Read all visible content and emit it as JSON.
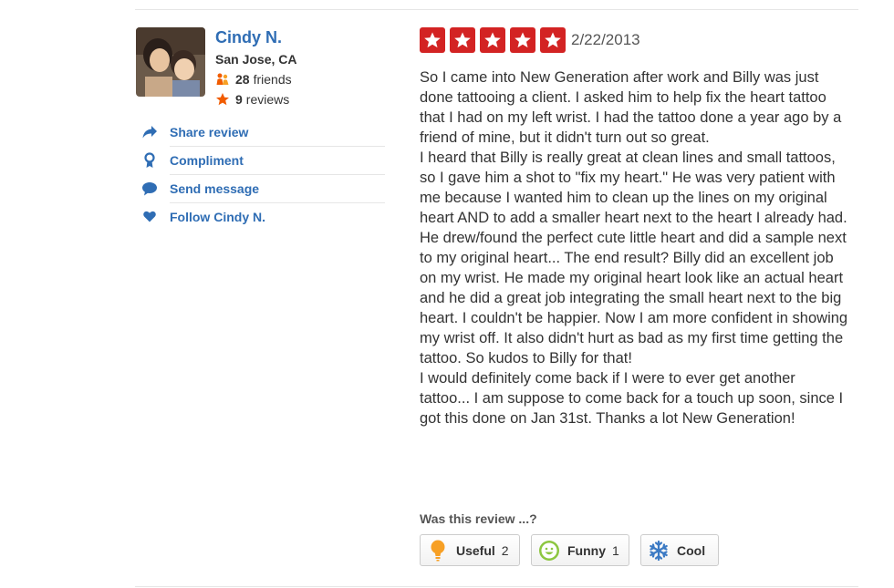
{
  "user": {
    "name": "Cindy N.",
    "location": "San Jose, CA",
    "friends_count": "28",
    "friends_label": "friends",
    "reviews_count": "9",
    "reviews_label": "reviews"
  },
  "actions": [
    {
      "label": "Share review",
      "icon": "share-arrow-icon"
    },
    {
      "label": "Compliment",
      "icon": "ribbon-icon"
    },
    {
      "label": "Send message",
      "icon": "speech-bubble-icon"
    },
    {
      "label": "Follow Cindy N.",
      "icon": "heart-icon"
    }
  ],
  "review": {
    "rating": 5,
    "max_rating": 5,
    "date": "2/22/2013",
    "paragraphs": [
      "So I came into New Generation after work and Billy was just done tattooing a client. I asked him to help fix the heart tattoo that I had on my left wrist. I had the tattoo done a year ago by a friend of mine, but it didn't turn out so great.",
      "I heard that Billy is really great at clean lines and small tattoos, so I gave him a shot to \"fix my heart.\" He was very patient with me because I wanted him to clean up the lines on my original heart AND to add a smaller heart next to the heart I already had. He drew/found the perfect cute little heart and did a sample next to my original heart... The end result? Billy did an excellent job on my wrist. He made my original heart look like an actual heart and he did a great job integrating the small heart next to the big heart. I couldn't be happier. Now I am more confident in showing my wrist off. It also didn't hurt as bad as my first time getting the tattoo. So kudos to Billy for that!",
      "I would definitely come back if I were to ever get another tattoo... I am suppose to come back for a touch up soon, since I got this done on Jan 31st. Thanks a lot New Generation!"
    ]
  },
  "votes": {
    "question": "Was this review ...?",
    "useful": {
      "label": "Useful",
      "count": "2"
    },
    "funny": {
      "label": "Funny",
      "count": "1"
    },
    "cool": {
      "label": "Cool",
      "count": ""
    }
  },
  "colors": {
    "link": "#2f6db4",
    "star_red": "#d32323",
    "friends_orange": "#f15c00",
    "useful_orange": "#f7a025",
    "funny_green": "#8cc63f",
    "cool_blue": "#3b7ac4"
  }
}
